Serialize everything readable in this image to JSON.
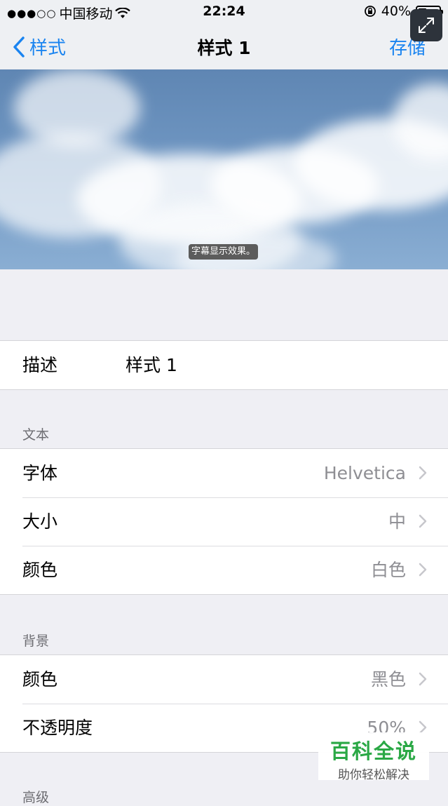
{
  "status": {
    "carrier": "中国移动",
    "time": "22:24",
    "battery": "40%",
    "signal_dots": "●●●○○",
    "battery_level": 0.4
  },
  "nav": {
    "back_label": "样式",
    "title": "样式 1",
    "save_label": "存储"
  },
  "preview": {
    "caption": "字幕显示效果。"
  },
  "description": {
    "label": "描述",
    "value": "样式 1"
  },
  "text_section": {
    "header": "文本",
    "rows": [
      {
        "label": "字体",
        "value": "Helvetica"
      },
      {
        "label": "大小",
        "value": "中"
      },
      {
        "label": "颜色",
        "value": "白色"
      }
    ]
  },
  "background_section": {
    "header": "背景",
    "rows": [
      {
        "label": "颜色",
        "value": "黑色"
      },
      {
        "label": "不透明度",
        "value": "50%"
      }
    ]
  },
  "advanced_section": {
    "header": "高级"
  },
  "watermark": {
    "title": "百科全说",
    "subtitle": "助你轻松解决"
  },
  "colors": {
    "accent": "#1a84f0",
    "background": "#efeff4",
    "secondary_text": "#8e8e93"
  }
}
